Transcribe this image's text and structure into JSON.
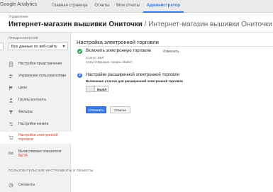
{
  "header": {
    "brand": "Google Analytics",
    "nav": [
      "Главная страница",
      "Отчеты",
      "Мои отчеты",
      "Администратор"
    ],
    "active_nav": 3,
    "small_breadcrumb": "Управление",
    "title_main": "Интернет-магазин вышивки Ониточки",
    "title_rest": " / Интернет-магазин вышивки Ониточки / Все данные по ве"
  },
  "sidebar": {
    "section_label": "ПРЕДСТАВЛЕНИЕ",
    "view_select_value": "Все данные по веб-сайту",
    "items": [
      {
        "label": "Настройки представления",
        "icon": "document-icon"
      },
      {
        "label": "Управление пользователями",
        "icon": "users-icon"
      },
      {
        "label": "Цели",
        "icon": "flag-icon"
      },
      {
        "label": "Группы контента",
        "icon": "person-icon"
      },
      {
        "label": "Фильтры",
        "icon": "filter-icon"
      },
      {
        "label": "Настройки канала",
        "icon": "sliders-icon"
      },
      {
        "label": "Настройки электронной торговли",
        "icon": "cart-icon"
      },
      {
        "label": "Вычисляемые показатели",
        "sub": "БЕТА",
        "icon": "calc-icon"
      }
    ],
    "active_item": 6,
    "section2_label": "ПОЛЬЗОВАТЕЛЬСКИЕ ИНСТРУМЕНТЫ И ОБЪЕКТЫ",
    "section2_items": [
      {
        "label": "Сегменты",
        "icon": "segment-icon"
      }
    ]
  },
  "panel": {
    "title": "Настройка электронной торговли",
    "step1": {
      "title": "Включить электронную торговлю",
      "edit": "Изменить",
      "status": "Статус: ВКЛ",
      "related": "Сопутствующие товары: ВЫКЛ"
    },
    "step2": {
      "number": "2",
      "title": "Настройки расширенной электронной торговли",
      "toggle_label": "Включение отчетов для расширенной электронной торговли",
      "toggle_value": "ВЫКЛ"
    },
    "submit": "Отправить",
    "cancel": "Отмена"
  },
  "colors": {
    "accent": "#3b78e7",
    "active_red": "#d23f31",
    "success": "#2ea84f"
  }
}
